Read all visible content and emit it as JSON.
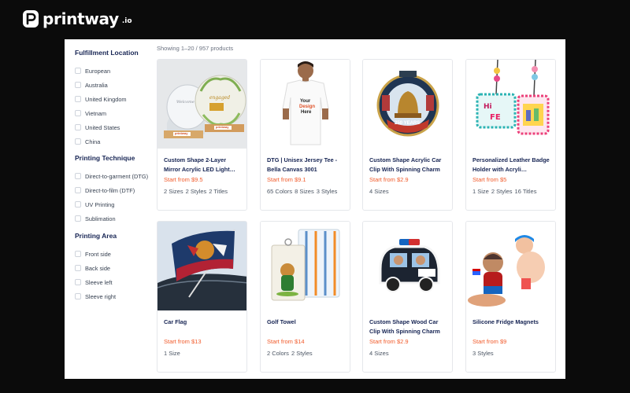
{
  "brand": {
    "name": "printway",
    "suffix": ".io"
  },
  "result_count": "Showing 1–20 / 957 products",
  "filters": [
    {
      "title": "Fulfillment Location",
      "options": [
        "European",
        "Australia",
        "United Kingdom",
        "Vietnam",
        "United States",
        "China"
      ]
    },
    {
      "title": "Printing Technique",
      "options": [
        "Direct-to-garment (DTG)",
        "Direct-to-film (DTF)",
        "UV Printing",
        "Sublimation"
      ]
    },
    {
      "title": "Printing Area",
      "options": [
        "Front side",
        "Back side",
        "Sleeve left",
        "Sleeve right"
      ]
    }
  ],
  "products": [
    {
      "name": "Custom Shape 2-Layer Mirror Acrylic LED Light…",
      "price": "Start from $9.5",
      "meta": [
        "2 Sizes",
        "2 Styles",
        "2 Titles"
      ],
      "image": "acrylic-led-light",
      "image_labels": [
        "printway",
        "printway"
      ]
    },
    {
      "name": "DTG | Unisex Jersey Tee - Bella Canvas 3001",
      "price": "Start from $9.1",
      "meta": [
        "65 Colors",
        "8 Sizes",
        "3 Styles"
      ],
      "image": "tshirt",
      "image_labels": [
        "Your",
        "Design",
        "Here"
      ]
    },
    {
      "name": "Custom Shape Acrylic Car Clip With Spinning Charm",
      "price": "Start from $2.9",
      "meta": [
        "4 Sizes"
      ],
      "image": "car-clip-badge",
      "image_labels": [
        "250 YEARS"
      ]
    },
    {
      "name": "Personalized Leather Badge Holder with Acryli…",
      "price": "Start from $5",
      "meta": [
        "1 Size",
        "2 Styles",
        "16 Titles"
      ],
      "image": "badge-holder",
      "image_labels": []
    },
    {
      "name": "Car Flag",
      "price": "Start from $13",
      "meta": [
        "1 Size"
      ],
      "image": "car-flag",
      "image_labels": []
    },
    {
      "name": "Golf Towel",
      "price": "Start from $14",
      "meta": [
        "2 Colors",
        "2 Styles"
      ],
      "image": "golf-towel",
      "image_labels": []
    },
    {
      "name": "Custom Shape Wood Car Clip With Spinning Charm",
      "price": "Start from $2.9",
      "meta": [
        "4 Sizes"
      ],
      "image": "wood-car-clip",
      "image_labels": []
    },
    {
      "name": "Silicone Fridge Magnets",
      "price": "Start from $9",
      "meta": [
        "3 Styles"
      ],
      "image": "fridge-magnets",
      "image_labels": []
    }
  ],
  "colors": {
    "price": "#f15a2a",
    "heading": "#172554",
    "page_bg": "#0b0b0b"
  }
}
